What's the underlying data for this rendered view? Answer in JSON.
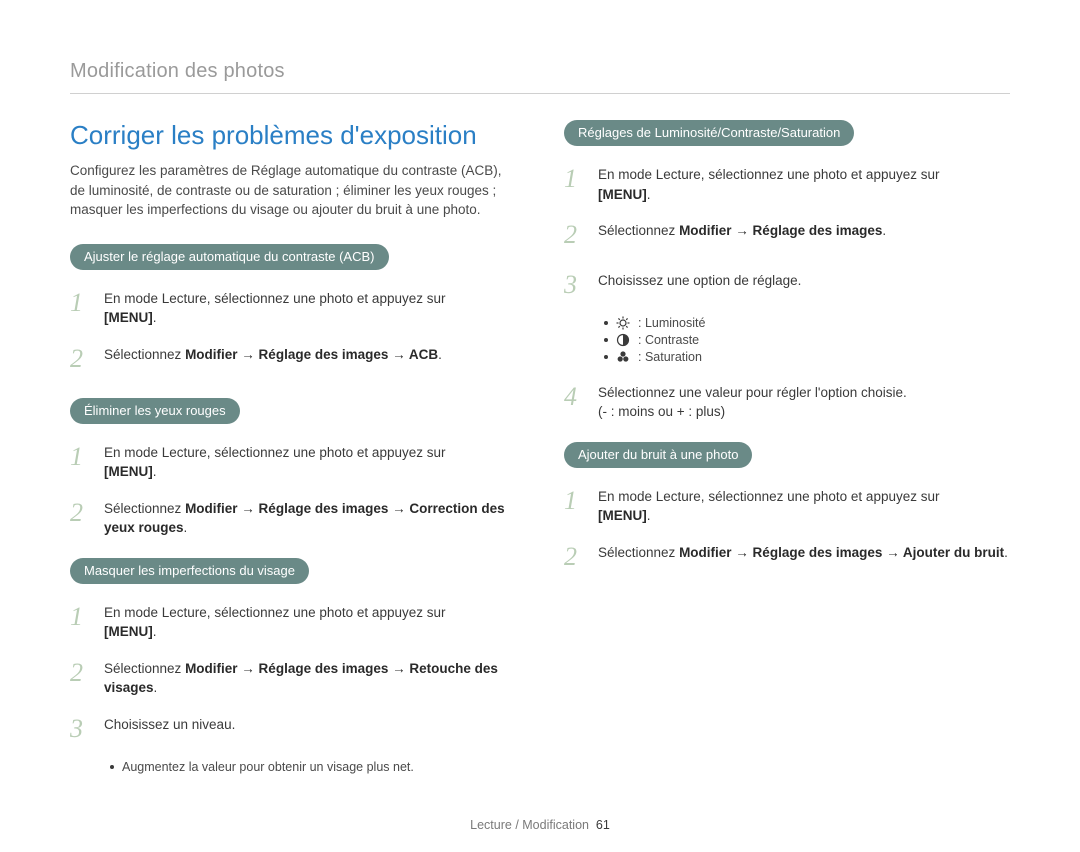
{
  "breadcrumb": "Modification des photos",
  "title": "Corriger les problèmes d'exposition",
  "intro": "Configurez les paramètres de Réglage automatique du contraste (ACB), de luminosité, de contraste ou de saturation ; éliminer les yeux rouges ; masquer les imperfections du visage ou ajouter du bruit à une photo.",
  "left": {
    "sec1": {
      "heading": "Ajuster le réglage automatique du contraste (ACB)",
      "step1_a": "En mode Lecture, sélectionnez une photo et appuyez sur ",
      "menu": "[MENU]",
      "dot": ".",
      "step2_a": "Sélectionnez ",
      "step2_b": "Modifier → Réglage des images → ACB",
      "step2_c": "."
    },
    "sec2": {
      "heading": "Éliminer les yeux rouges",
      "step1_a": "En mode Lecture, sélectionnez une photo et appuyez sur ",
      "menu": "[MENU]",
      "dot": ".",
      "step2_a": "Sélectionnez ",
      "step2_b": "Modifier → Réglage des images → Correction des yeux rouges",
      "step2_c": "."
    },
    "sec3": {
      "heading": "Masquer les imperfections du visage",
      "step1_a": "En mode Lecture, sélectionnez une photo et appuyez sur ",
      "menu": "[MENU]",
      "dot": ".",
      "step2_a": "Sélectionnez ",
      "step2_b": "Modifier → Réglage des images → Retouche des visages",
      "step2_c": ".",
      "step3": "Choisissez un niveau.",
      "bullet": "Augmentez la valeur pour obtenir un visage plus net."
    }
  },
  "right": {
    "sec1": {
      "heading": "Réglages de Luminosité/Contraste/Saturation",
      "step1_a": "En mode Lecture, sélectionnez une photo et appuyez sur ",
      "menu": "[MENU]",
      "dot": ".",
      "step2_a": "Sélectionnez ",
      "step2_b": "Modifier → Réglage des images",
      "step2_c": ".",
      "step3": "Choisissez une option de réglage.",
      "opt1": ": Luminosité",
      "opt2": ": Contraste",
      "opt3": ": Saturation",
      "step4_a": "Sélectionnez une valeur pour régler l'option choisie.",
      "step4_b": "(- : moins ou + : plus)"
    },
    "sec2": {
      "heading": "Ajouter du bruit à une photo",
      "step1_a": "En mode Lecture, sélectionnez une photo et appuyez sur ",
      "menu": "[MENU]",
      "dot": ".",
      "step2_a": "Sélectionnez ",
      "step2_b": "Modifier → Réglage des images → Ajouter du bruit",
      "step2_c": "."
    }
  },
  "footer": {
    "label": "Lecture / Modification",
    "page": "61"
  },
  "nums": {
    "n1": "1",
    "n2": "2",
    "n3": "3",
    "n4": "4"
  }
}
